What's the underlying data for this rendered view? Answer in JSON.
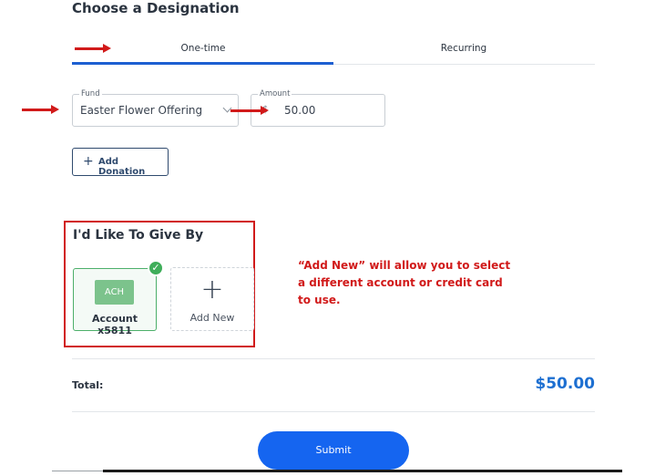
{
  "header": {
    "title": "Choose a Designation"
  },
  "tabs": [
    {
      "label": "One-time",
      "active": true
    },
    {
      "label": "Recurring",
      "active": false
    }
  ],
  "fund": {
    "label": "Fund",
    "value": "Easter Flower Offering"
  },
  "amount": {
    "label": "Amount",
    "currency": "$",
    "value": "50.00"
  },
  "add_donation": {
    "icon": "plus-icon",
    "label": "Add Donation"
  },
  "give_by": {
    "title": "I'd Like To Give By",
    "ach_card": {
      "badge": "ACH",
      "label": "Account x5811",
      "selected_icon": "check-icon"
    },
    "add_new": {
      "icon": "plus-icon",
      "label": "Add New"
    }
  },
  "annotation": "“Add New” will allow you to select a different account or credit card to use.",
  "total": {
    "label": "Total:",
    "value": "$50.00"
  },
  "submit": {
    "label": "Submit"
  },
  "colors": {
    "accent": "#1565f0",
    "annotation_red": "#d11a1a",
    "selected_green": "#3fae5a"
  }
}
